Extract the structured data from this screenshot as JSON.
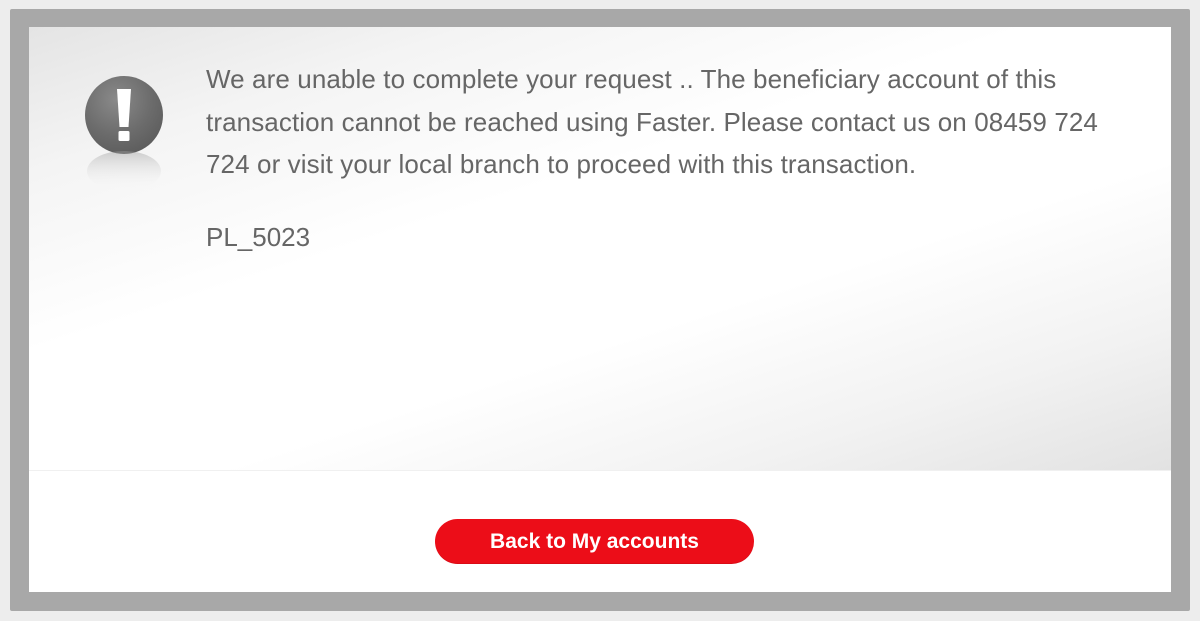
{
  "alert": {
    "icon": "exclamation-icon",
    "message": "We are unable to complete your request .. The beneficiary account of this transaction cannot be reached using Faster. Please contact us on 08459 724 724 or visit your local branch to proceed with this transaction.",
    "error_code": "PL_5023"
  },
  "actions": {
    "back_label": "Back to My accounts"
  },
  "colors": {
    "button_red": "#ec0d18",
    "text_gray": "#666666",
    "frame_gray": "#a8a8a8"
  }
}
